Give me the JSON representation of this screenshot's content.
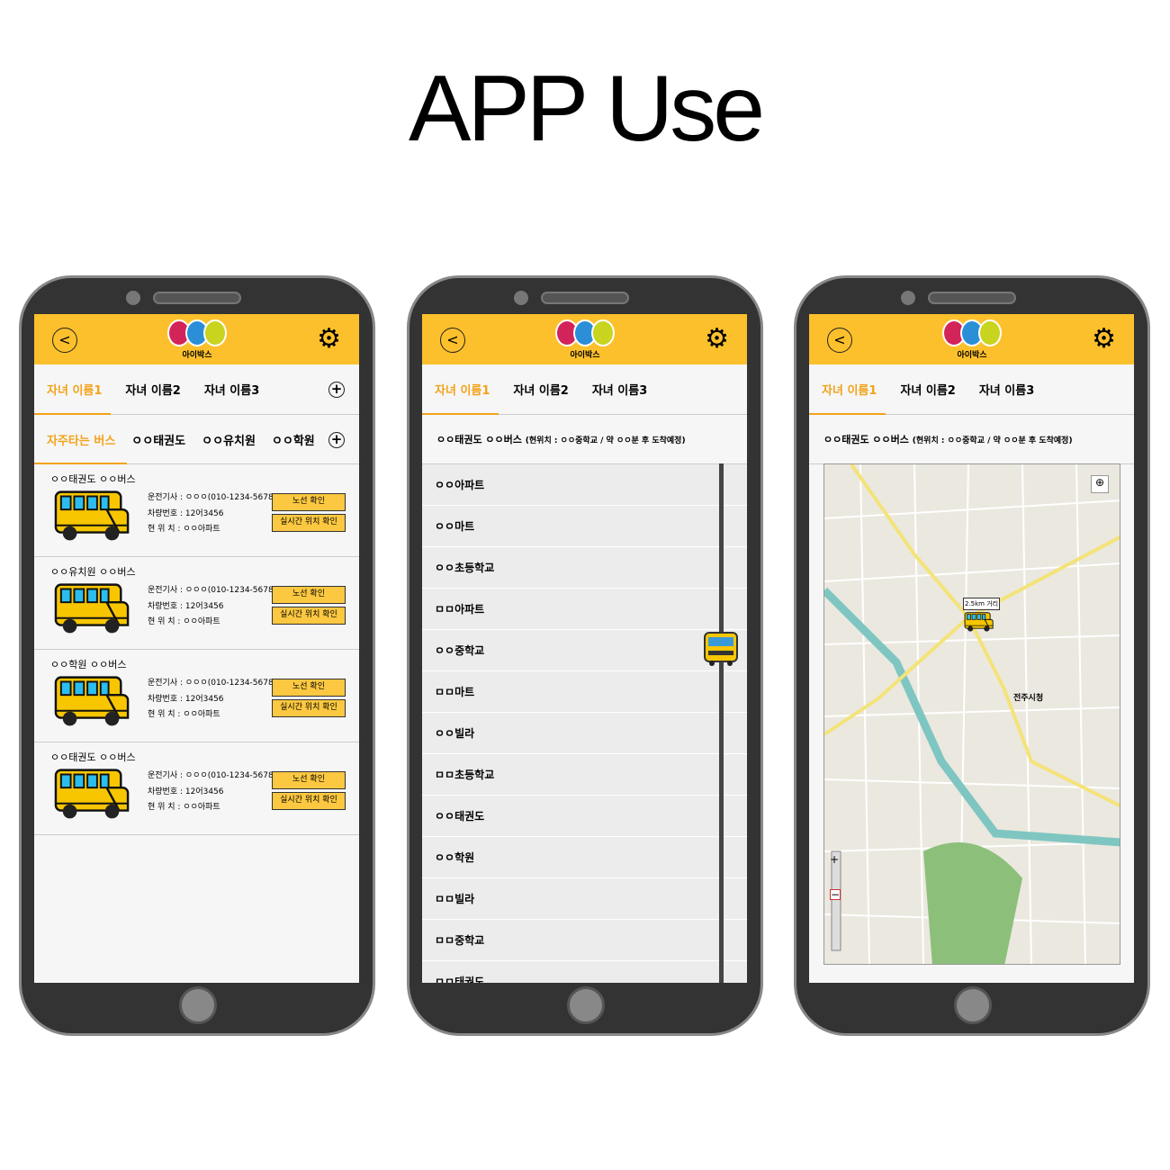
{
  "title": "APP Use",
  "app": {
    "logo_text": "아이박스",
    "back_icon": "chevron-left-icon",
    "settings_icon": "gear-icon"
  },
  "child_tabs": [
    "자녀 이름1",
    "자녀 이름2",
    "자녀 이름3"
  ],
  "bus_tabs": [
    "자주타는 버스",
    "ㅇㅇ태권도",
    "ㅇㅇ유치원",
    "ㅇㅇ학원"
  ],
  "buses": [
    {
      "name": "ㅇㅇ태권도 ㅇㅇ버스",
      "driver": "운전기사 : ㅇㅇㅇ(010-1234-5678)",
      "plate": "차량번호 : 12어3456",
      "location": "현 위 치 : ㅇㅇ아파트"
    },
    {
      "name": "ㅇㅇ유치원 ㅇㅇ버스",
      "driver": "운전기사 : ㅇㅇㅇ(010-1234-5678)",
      "plate": "차량번호 : 12어3456",
      "location": "현 위 치 : ㅇㅇ아파트"
    },
    {
      "name": "ㅇㅇ학원 ㅇㅇ버스",
      "driver": "운전기사 : ㅇㅇㅇ(010-1234-5678)",
      "plate": "차량번호 : 12어3456",
      "location": "현 위 치 : ㅇㅇ아파트"
    },
    {
      "name": "ㅇㅇ태권도 ㅇㅇ버스",
      "driver": "운전기사 : ㅇㅇㅇ(010-1234-5678)",
      "plate": "차량번호 : 12어3456",
      "location": "현 위 치 : ㅇㅇ아파트"
    }
  ],
  "buttons": {
    "route": "노선 확인",
    "realtime": "실시간 위치 확인"
  },
  "route_header": {
    "name": "ㅇㅇ태권도 ㅇㅇ버스",
    "status": "(현위치 : ㅇㅇ중학교 / 약 ㅇㅇ분 후 도착예정)"
  },
  "stops": [
    "ㅇㅇ아파트",
    "ㅇㅇ마트",
    "ㅇㅇ초등학교",
    "ㅁㅁ아파트",
    "ㅇㅇ중학교",
    "ㅁㅁ마트",
    "ㅇㅇ빌라",
    "ㅁㅁ초등학교",
    "ㅇㅇ태권도",
    "ㅇㅇ학원",
    "ㅁㅁ빌라",
    "ㅁㅁ중학교",
    "ㅁㅁ태권도"
  ],
  "map": {
    "distance_label": "2.5km 거리",
    "city_hall": "전주시청",
    "zoom_in": "+",
    "zoom_out": "−"
  },
  "colors": {
    "accent": "#fcc02c",
    "active_tab": "#f2a31a"
  }
}
